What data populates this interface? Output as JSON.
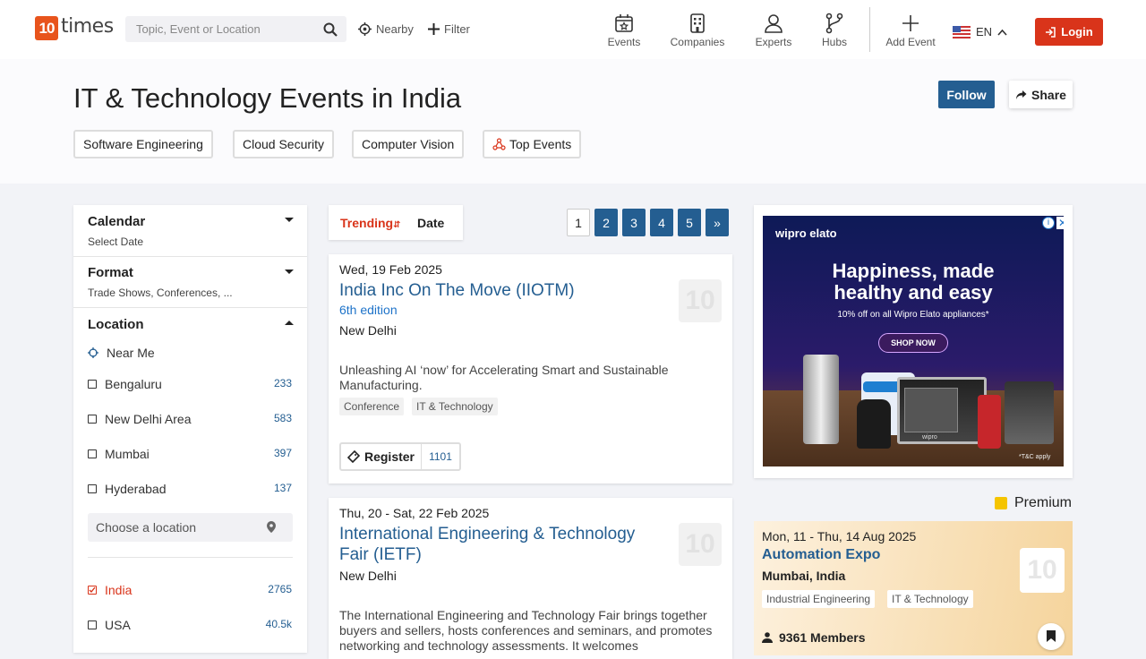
{
  "brand": {
    "logo_num": "10",
    "logo_text": "times"
  },
  "search": {
    "placeholder": "Topic, Event or Location"
  },
  "header": {
    "nearby": "Nearby",
    "filter": "Filter",
    "nav": [
      "Events",
      "Companies",
      "Experts",
      "Hubs",
      "Add Event"
    ],
    "lang": "EN",
    "login": "Login"
  },
  "page": {
    "title": "IT & Technology Events in India",
    "follow": "Follow",
    "share": "Share",
    "chips": [
      "Software Engineering",
      "Cloud Security",
      "Computer Vision",
      "Top Events"
    ]
  },
  "filters": {
    "calendar": {
      "title": "Calendar",
      "sub": "Select Date"
    },
    "format": {
      "title": "Format",
      "sub": "Trade Shows, Conferences, ..."
    },
    "location": {
      "title": "Location",
      "near_me": "Near Me",
      "cities": [
        {
          "name": "Bengaluru",
          "count": "233"
        },
        {
          "name": "New Delhi Area",
          "count": "583"
        },
        {
          "name": "Mumbai",
          "count": "397"
        },
        {
          "name": "Hyderabad",
          "count": "137"
        }
      ],
      "placeholder": "Choose a location",
      "countries": [
        {
          "name": "India",
          "count": "2765"
        },
        {
          "name": "USA",
          "count": "40.5k"
        }
      ]
    }
  },
  "list": {
    "sort": {
      "trending": "Trending",
      "date": "Date"
    },
    "pages": [
      "1",
      "2",
      "3",
      "4",
      "5",
      "»"
    ],
    "events": [
      {
        "date": "Wed, 19 Feb 2025",
        "title": "India Inc On The Move (IIOTM)",
        "edition": "6th edition",
        "city": "New Delhi",
        "desc": "Unleashing AI ‘now’ for Accelerating Smart and Sustainable Manufacturing.",
        "tags": [
          "Conference",
          "IT & Technology"
        ],
        "register": "Register",
        "count": "1101",
        "logo": "10"
      },
      {
        "date": "Thu, 20 - Sat, 22 Feb 2025",
        "title": "International Engineering & Technology Fair (IETF)",
        "city": "New Delhi",
        "desc": "The International Engineering and Technology Fair brings together buyers and sellers, hosts conferences and seminars, and promotes networking and technology assessments. It welcomes",
        "logo": "10"
      }
    ]
  },
  "ad": {
    "brand": "wipro elato",
    "headline1": "Happiness, made",
    "headline2": "healthy and easy",
    "offer": "10% off on all Wipro Elato appliances*",
    "cta": "SHOP NOW",
    "fine": "*T&C apply",
    "product_brand": "wipro"
  },
  "premium": {
    "label": "Premium",
    "event": {
      "date": "Mon, 11 - Thu, 14 Aug 2025",
      "title": "Automation Expo",
      "city": "Mumbai, India",
      "tags": [
        "Industrial Engineering",
        "IT & Technology"
      ],
      "members": "9361 Members",
      "logo": "10"
    }
  }
}
